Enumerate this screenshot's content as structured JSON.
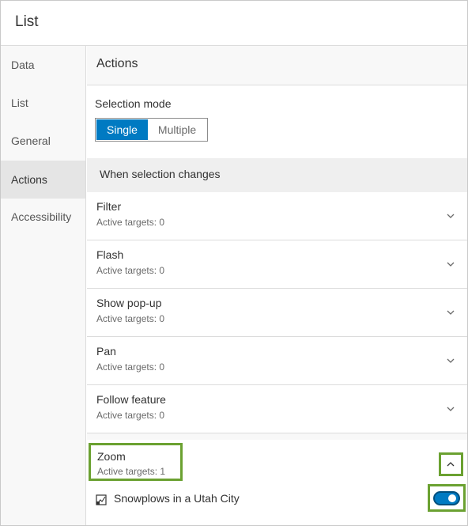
{
  "panel": {
    "title": "List"
  },
  "sidebar": {
    "items": [
      {
        "label": "Data"
      },
      {
        "label": "List"
      },
      {
        "label": "General"
      },
      {
        "label": "Actions"
      },
      {
        "label": "Accessibility"
      }
    ],
    "active": "Actions"
  },
  "content": {
    "header": "Actions",
    "selection_mode": {
      "label": "Selection mode",
      "options": [
        "Single",
        "Multiple"
      ],
      "selected": "Single"
    },
    "when_selection_changes": "When selection changes",
    "actions": [
      {
        "name": "Filter",
        "active_targets": "Active targets: 0"
      },
      {
        "name": "Flash",
        "active_targets": "Active targets: 0"
      },
      {
        "name": "Show pop-up",
        "active_targets": "Active targets: 0"
      },
      {
        "name": "Pan",
        "active_targets": "Active targets: 0"
      },
      {
        "name": "Follow feature",
        "active_targets": "Active targets: 0"
      }
    ],
    "zoom": {
      "name": "Zoom",
      "active_targets": "Active targets: 1",
      "expanded": true,
      "target": {
        "label": "Snowplows in a Utah City",
        "enabled": true
      }
    }
  },
  "colors": {
    "accent": "#007ac2",
    "highlight": "#6ba131"
  },
  "icons": [
    "chevron-down-icon",
    "chevron-up-icon",
    "map-widget-icon",
    "toggle-switch"
  ]
}
